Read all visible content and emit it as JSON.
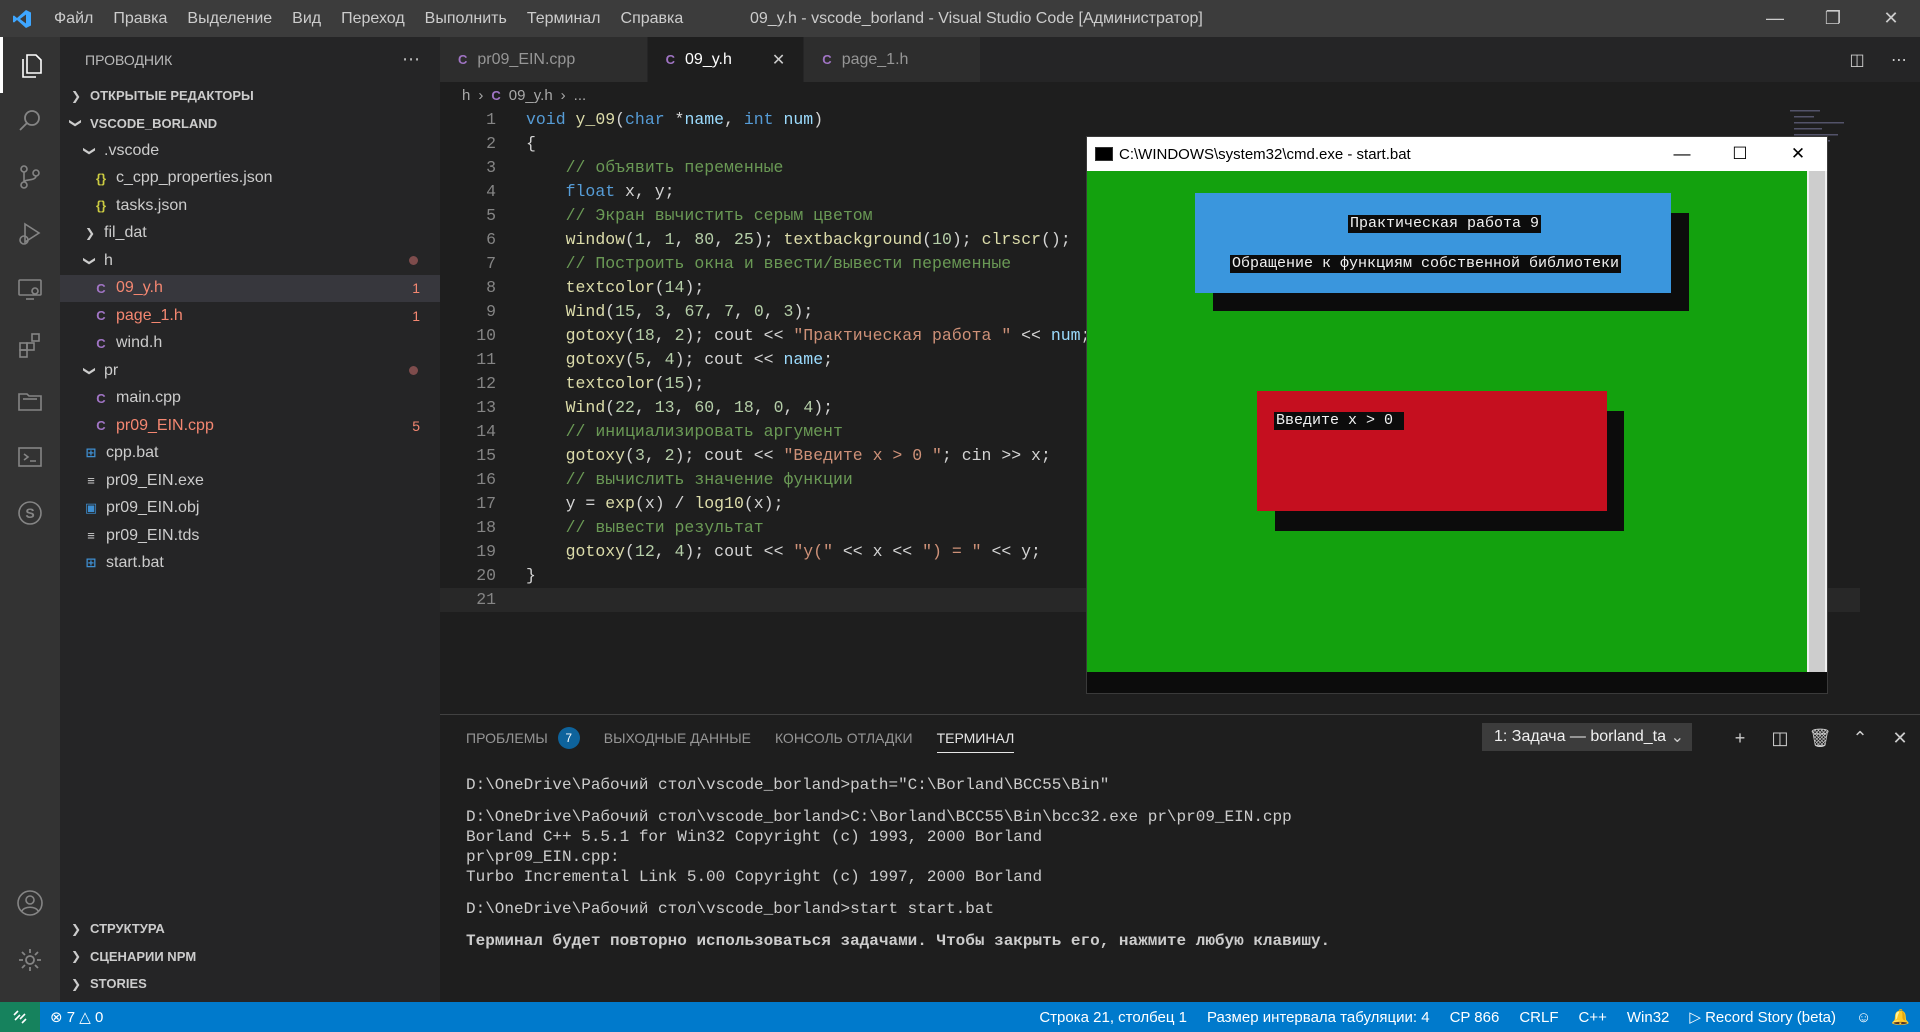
{
  "titlebar": {
    "menu": [
      "Файл",
      "Правка",
      "Выделение",
      "Вид",
      "Переход",
      "Выполнить",
      "Терминал",
      "Справка"
    ],
    "title": "09_y.h - vscode_borland - Visual Studio Code [Администратор]"
  },
  "sidebar": {
    "header": "ПРОВОДНИК",
    "open_editors": "ОТКРЫТЫЕ РЕДАКТОРЫ",
    "workspace": "VSCODE_BORLAND",
    "tree": [
      {
        "label": ".vscode",
        "kind": "folder",
        "open": true,
        "level": 1
      },
      {
        "label": "c_cpp_properties.json",
        "kind": "json",
        "level": 2
      },
      {
        "label": "tasks.json",
        "kind": "json",
        "level": 2
      },
      {
        "label": "fil_dat",
        "kind": "folder",
        "open": false,
        "level": 1
      },
      {
        "label": "h",
        "kind": "folder",
        "open": true,
        "level": 1,
        "error_dot": true
      },
      {
        "label": "09_y.h",
        "kind": "c",
        "level": 2,
        "badge": "1",
        "error": true,
        "selected": true
      },
      {
        "label": "page_1.h",
        "kind": "c",
        "level": 2,
        "badge": "1",
        "error": true
      },
      {
        "label": "wind.h",
        "kind": "c",
        "level": 2
      },
      {
        "label": "pr",
        "kind": "folder",
        "open": true,
        "level": 1,
        "error_dot": true
      },
      {
        "label": "main.cpp",
        "kind": "cpp",
        "level": 2
      },
      {
        "label": "pr09_EIN.cpp",
        "kind": "cpp",
        "level": 2,
        "badge": "5",
        "error": true
      },
      {
        "label": "cpp.bat",
        "kind": "win",
        "level": 1
      },
      {
        "label": "pr09_EIN.exe",
        "kind": "file",
        "level": 1
      },
      {
        "label": "pr09_EIN.obj",
        "kind": "obj",
        "level": 1
      },
      {
        "label": "pr09_EIN.tds",
        "kind": "file",
        "level": 1
      },
      {
        "label": "start.bat",
        "kind": "win",
        "level": 1
      }
    ],
    "bottom_sections": [
      "СТРУКТУРА",
      "СЦЕНАРИИ NPM",
      "STORIES"
    ]
  },
  "tabs": [
    {
      "label": "pr09_EIN.cpp",
      "active": false
    },
    {
      "label": "09_y.h",
      "active": true
    },
    {
      "label": "page_1.h",
      "active": false
    }
  ],
  "breadcrumb": [
    "h",
    "09_y.h",
    "..."
  ],
  "code": {
    "current_line": 21,
    "lines": [
      [
        [
          "kw",
          "void"
        ],
        [
          "op",
          " "
        ],
        [
          "fn",
          "y_09"
        ],
        [
          "op",
          "("
        ],
        [
          "kw",
          "char"
        ],
        [
          "op",
          " *"
        ],
        [
          "var",
          "name"
        ],
        [
          "op",
          ", "
        ],
        [
          "kw",
          "int"
        ],
        [
          "op",
          " "
        ],
        [
          "var",
          "num"
        ],
        [
          "op",
          ")"
        ]
      ],
      [
        [
          "op",
          "{"
        ]
      ],
      [
        [
          "op",
          "    "
        ],
        [
          "cm",
          "// объявить переменные"
        ]
      ],
      [
        [
          "op",
          "    "
        ],
        [
          "kw",
          "float"
        ],
        [
          "op",
          " x, y;"
        ]
      ],
      [
        [
          "op",
          "    "
        ],
        [
          "cm",
          "// Экран вычистить серым цветом"
        ]
      ],
      [
        [
          "op",
          "    "
        ],
        [
          "fn",
          "window"
        ],
        [
          "op",
          "("
        ],
        [
          "num",
          "1"
        ],
        [
          "op",
          ", "
        ],
        [
          "num",
          "1"
        ],
        [
          "op",
          ", "
        ],
        [
          "num",
          "80"
        ],
        [
          "op",
          ", "
        ],
        [
          "num",
          "25"
        ],
        [
          "op",
          "); "
        ],
        [
          "fn",
          "textbackground"
        ],
        [
          "op",
          "("
        ],
        [
          "num",
          "10"
        ],
        [
          "op",
          "); "
        ],
        [
          "fn",
          "clrscr"
        ],
        [
          "op",
          "();"
        ]
      ],
      [
        [
          "op",
          "    "
        ],
        [
          "cm",
          "// Построить окна и ввести/вывести переменные"
        ]
      ],
      [
        [
          "op",
          "    "
        ],
        [
          "fn",
          "textcolor"
        ],
        [
          "op",
          "("
        ],
        [
          "num",
          "14"
        ],
        [
          "op",
          ");"
        ]
      ],
      [
        [
          "op",
          "    "
        ],
        [
          "fn",
          "Wind"
        ],
        [
          "op",
          "("
        ],
        [
          "num",
          "15"
        ],
        [
          "op",
          ", "
        ],
        [
          "num",
          "3"
        ],
        [
          "op",
          ", "
        ],
        [
          "num",
          "67"
        ],
        [
          "op",
          ", "
        ],
        [
          "num",
          "7"
        ],
        [
          "op",
          ", "
        ],
        [
          "num",
          "0"
        ],
        [
          "op",
          ", "
        ],
        [
          "num",
          "3"
        ],
        [
          "op",
          ");"
        ]
      ],
      [
        [
          "op",
          "    "
        ],
        [
          "fn",
          "gotoxy"
        ],
        [
          "op",
          "("
        ],
        [
          "num",
          "18"
        ],
        [
          "op",
          ", "
        ],
        [
          "num",
          "2"
        ],
        [
          "op",
          "); cout << "
        ],
        [
          "str",
          "\"Практическая работа \""
        ],
        [
          "op",
          " << "
        ],
        [
          "var",
          "num"
        ],
        [
          "op",
          ";"
        ]
      ],
      [
        [
          "op",
          "    "
        ],
        [
          "fn",
          "gotoxy"
        ],
        [
          "op",
          "("
        ],
        [
          "num",
          "5"
        ],
        [
          "op",
          ", "
        ],
        [
          "num",
          "4"
        ],
        [
          "op",
          "); cout << "
        ],
        [
          "var",
          "name"
        ],
        [
          "op",
          ";"
        ]
      ],
      [
        [
          "op",
          "    "
        ],
        [
          "fn",
          "textcolor"
        ],
        [
          "op",
          "("
        ],
        [
          "num",
          "15"
        ],
        [
          "op",
          ");"
        ]
      ],
      [
        [
          "op",
          "    "
        ],
        [
          "fn",
          "Wind"
        ],
        [
          "op",
          "("
        ],
        [
          "num",
          "22"
        ],
        [
          "op",
          ", "
        ],
        [
          "num",
          "13"
        ],
        [
          "op",
          ", "
        ],
        [
          "num",
          "60"
        ],
        [
          "op",
          ", "
        ],
        [
          "num",
          "18"
        ],
        [
          "op",
          ", "
        ],
        [
          "num",
          "0"
        ],
        [
          "op",
          ", "
        ],
        [
          "num",
          "4"
        ],
        [
          "op",
          ");"
        ]
      ],
      [
        [
          "op",
          "    "
        ],
        [
          "cm",
          "// инициализировать аргумент"
        ]
      ],
      [
        [
          "op",
          "    "
        ],
        [
          "fn",
          "gotoxy"
        ],
        [
          "op",
          "("
        ],
        [
          "num",
          "3"
        ],
        [
          "op",
          ", "
        ],
        [
          "num",
          "2"
        ],
        [
          "op",
          "); cout << "
        ],
        [
          "str",
          "\"Введите x > 0 \""
        ],
        [
          "op",
          "; cin >> x;"
        ]
      ],
      [
        [
          "op",
          "    "
        ],
        [
          "cm",
          "// вычислить значение функции"
        ]
      ],
      [
        [
          "op",
          "    y = "
        ],
        [
          "fn",
          "exp"
        ],
        [
          "op",
          "(x) / "
        ],
        [
          "fn",
          "log10"
        ],
        [
          "op",
          "(x);"
        ]
      ],
      [
        [
          "op",
          "    "
        ],
        [
          "cm",
          "// вывести результат"
        ]
      ],
      [
        [
          "op",
          "    "
        ],
        [
          "fn",
          "gotoxy"
        ],
        [
          "op",
          "("
        ],
        [
          "num",
          "12"
        ],
        [
          "op",
          ", "
        ],
        [
          "num",
          "4"
        ],
        [
          "op",
          "); cout << "
        ],
        [
          "str",
          "\"y(\""
        ],
        [
          "op",
          " << x << "
        ],
        [
          "str",
          "\") = \""
        ],
        [
          "op",
          " << y;"
        ]
      ],
      [
        [
          "op",
          "}"
        ]
      ],
      [
        [
          "op",
          ""
        ]
      ]
    ]
  },
  "cmd": {
    "title": "C:\\WINDOWS\\system32\\cmd.exe - start.bat",
    "heading": "Практическая работа 9",
    "subheading": "Обращение к функциям собственной библиотеки",
    "prompt": "Введите x > 0 "
  },
  "panel": {
    "tabs": [
      {
        "label": "ПРОБЛЕМЫ",
        "badge": "7"
      },
      {
        "label": "ВЫХОДНЫЕ ДАННЫЕ"
      },
      {
        "label": "КОНСОЛЬ ОТЛАДКИ"
      },
      {
        "label": "ТЕРМИНАЛ",
        "active": true
      }
    ],
    "terminal_select": "1: Задача — borland_ta",
    "terminal_lines": [
      "D:\\OneDrive\\Рабочий стол\\vscode_borland>path=\"C:\\Borland\\BCC55\\Bin\"",
      "",
      "D:\\OneDrive\\Рабочий стол\\vscode_borland>C:\\Borland\\BCC55\\Bin\\bcc32.exe pr\\pr09_EIN.cpp",
      "Borland C++ 5.5.1 for Win32 Copyright (c) 1993, 2000 Borland",
      "pr\\pr09_EIN.cpp:",
      "Turbo Incremental Link 5.00 Copyright (c) 1997, 2000 Borland",
      "",
      "D:\\OneDrive\\Рабочий стол\\vscode_borland>start start.bat",
      "",
      "Терминал будет повторно использоваться задачами. Чтобы закрыть его, нажмите любую клавишу."
    ]
  },
  "statusbar": {
    "errors": "7",
    "warnings": "0",
    "position": "Строка 21, столбец 1",
    "tab_size": "Размер интервала табуляции: 4",
    "encoding": "CP 866",
    "eol": "CRLF",
    "language": "C++",
    "config": "Win32",
    "record": "Record Story (beta)"
  },
  "colors": {
    "accent": "#007acc",
    "cmd_green": "#13a10e",
    "cmd_blue": "#3a96dd",
    "cmd_red": "#c50f1f"
  }
}
